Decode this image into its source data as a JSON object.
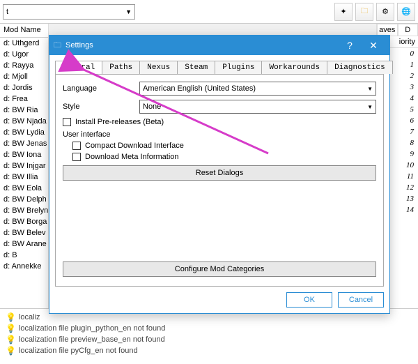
{
  "toolbar": {
    "combo_value": "t"
  },
  "left": {
    "header": "Mod Name",
    "items": [
      "d: Uthgerd",
      "d: Ugor",
      "d: Rayya",
      "d: Mjoll",
      "d: Jordis",
      "d: Frea",
      "d: BW Ria",
      "d: BW Njada",
      "d: BW Lydia",
      "d: BW Jenas",
      "d: BW Iona",
      "d: BW Injgar",
      "d: BW Illia",
      "d: BW Eola",
      "d: BW Delph",
      "d: BW Brelyn",
      "d: BW Borga",
      "d: BW Belev",
      "d: BW Arane",
      "d: B",
      "d: Annekke"
    ]
  },
  "right": {
    "headers": [
      "aves",
      "D"
    ],
    "priority_header": "iority",
    "priorities": [
      "0",
      "1",
      "2",
      "3",
      "4",
      "5",
      "6",
      "7",
      "8",
      "9",
      "10",
      "11",
      "12",
      "13",
      "14"
    ]
  },
  "dialog": {
    "title": "Settings",
    "tabs": [
      "General",
      "Paths",
      "Nexus",
      "Steam",
      "Plugins",
      "Workarounds",
      "Diagnostics"
    ],
    "language_label": "Language",
    "language_value": "American English (United States)",
    "style_label": "Style",
    "style_value": "None",
    "install_pre": "Install Pre-releases (Beta)",
    "ui_group": "User interface",
    "compact": "Compact Download Interface",
    "meta": "Download Meta Information",
    "reset": "Reset Dialogs",
    "configure": "Configure Mod Categories",
    "ok": "OK",
    "cancel": "Cancel"
  },
  "log": {
    "lines": [
      "localiz",
      "localization file plugin_python_en not found",
      "localization file preview_base_en not found",
      "localization file pyCfg_en not found"
    ]
  }
}
